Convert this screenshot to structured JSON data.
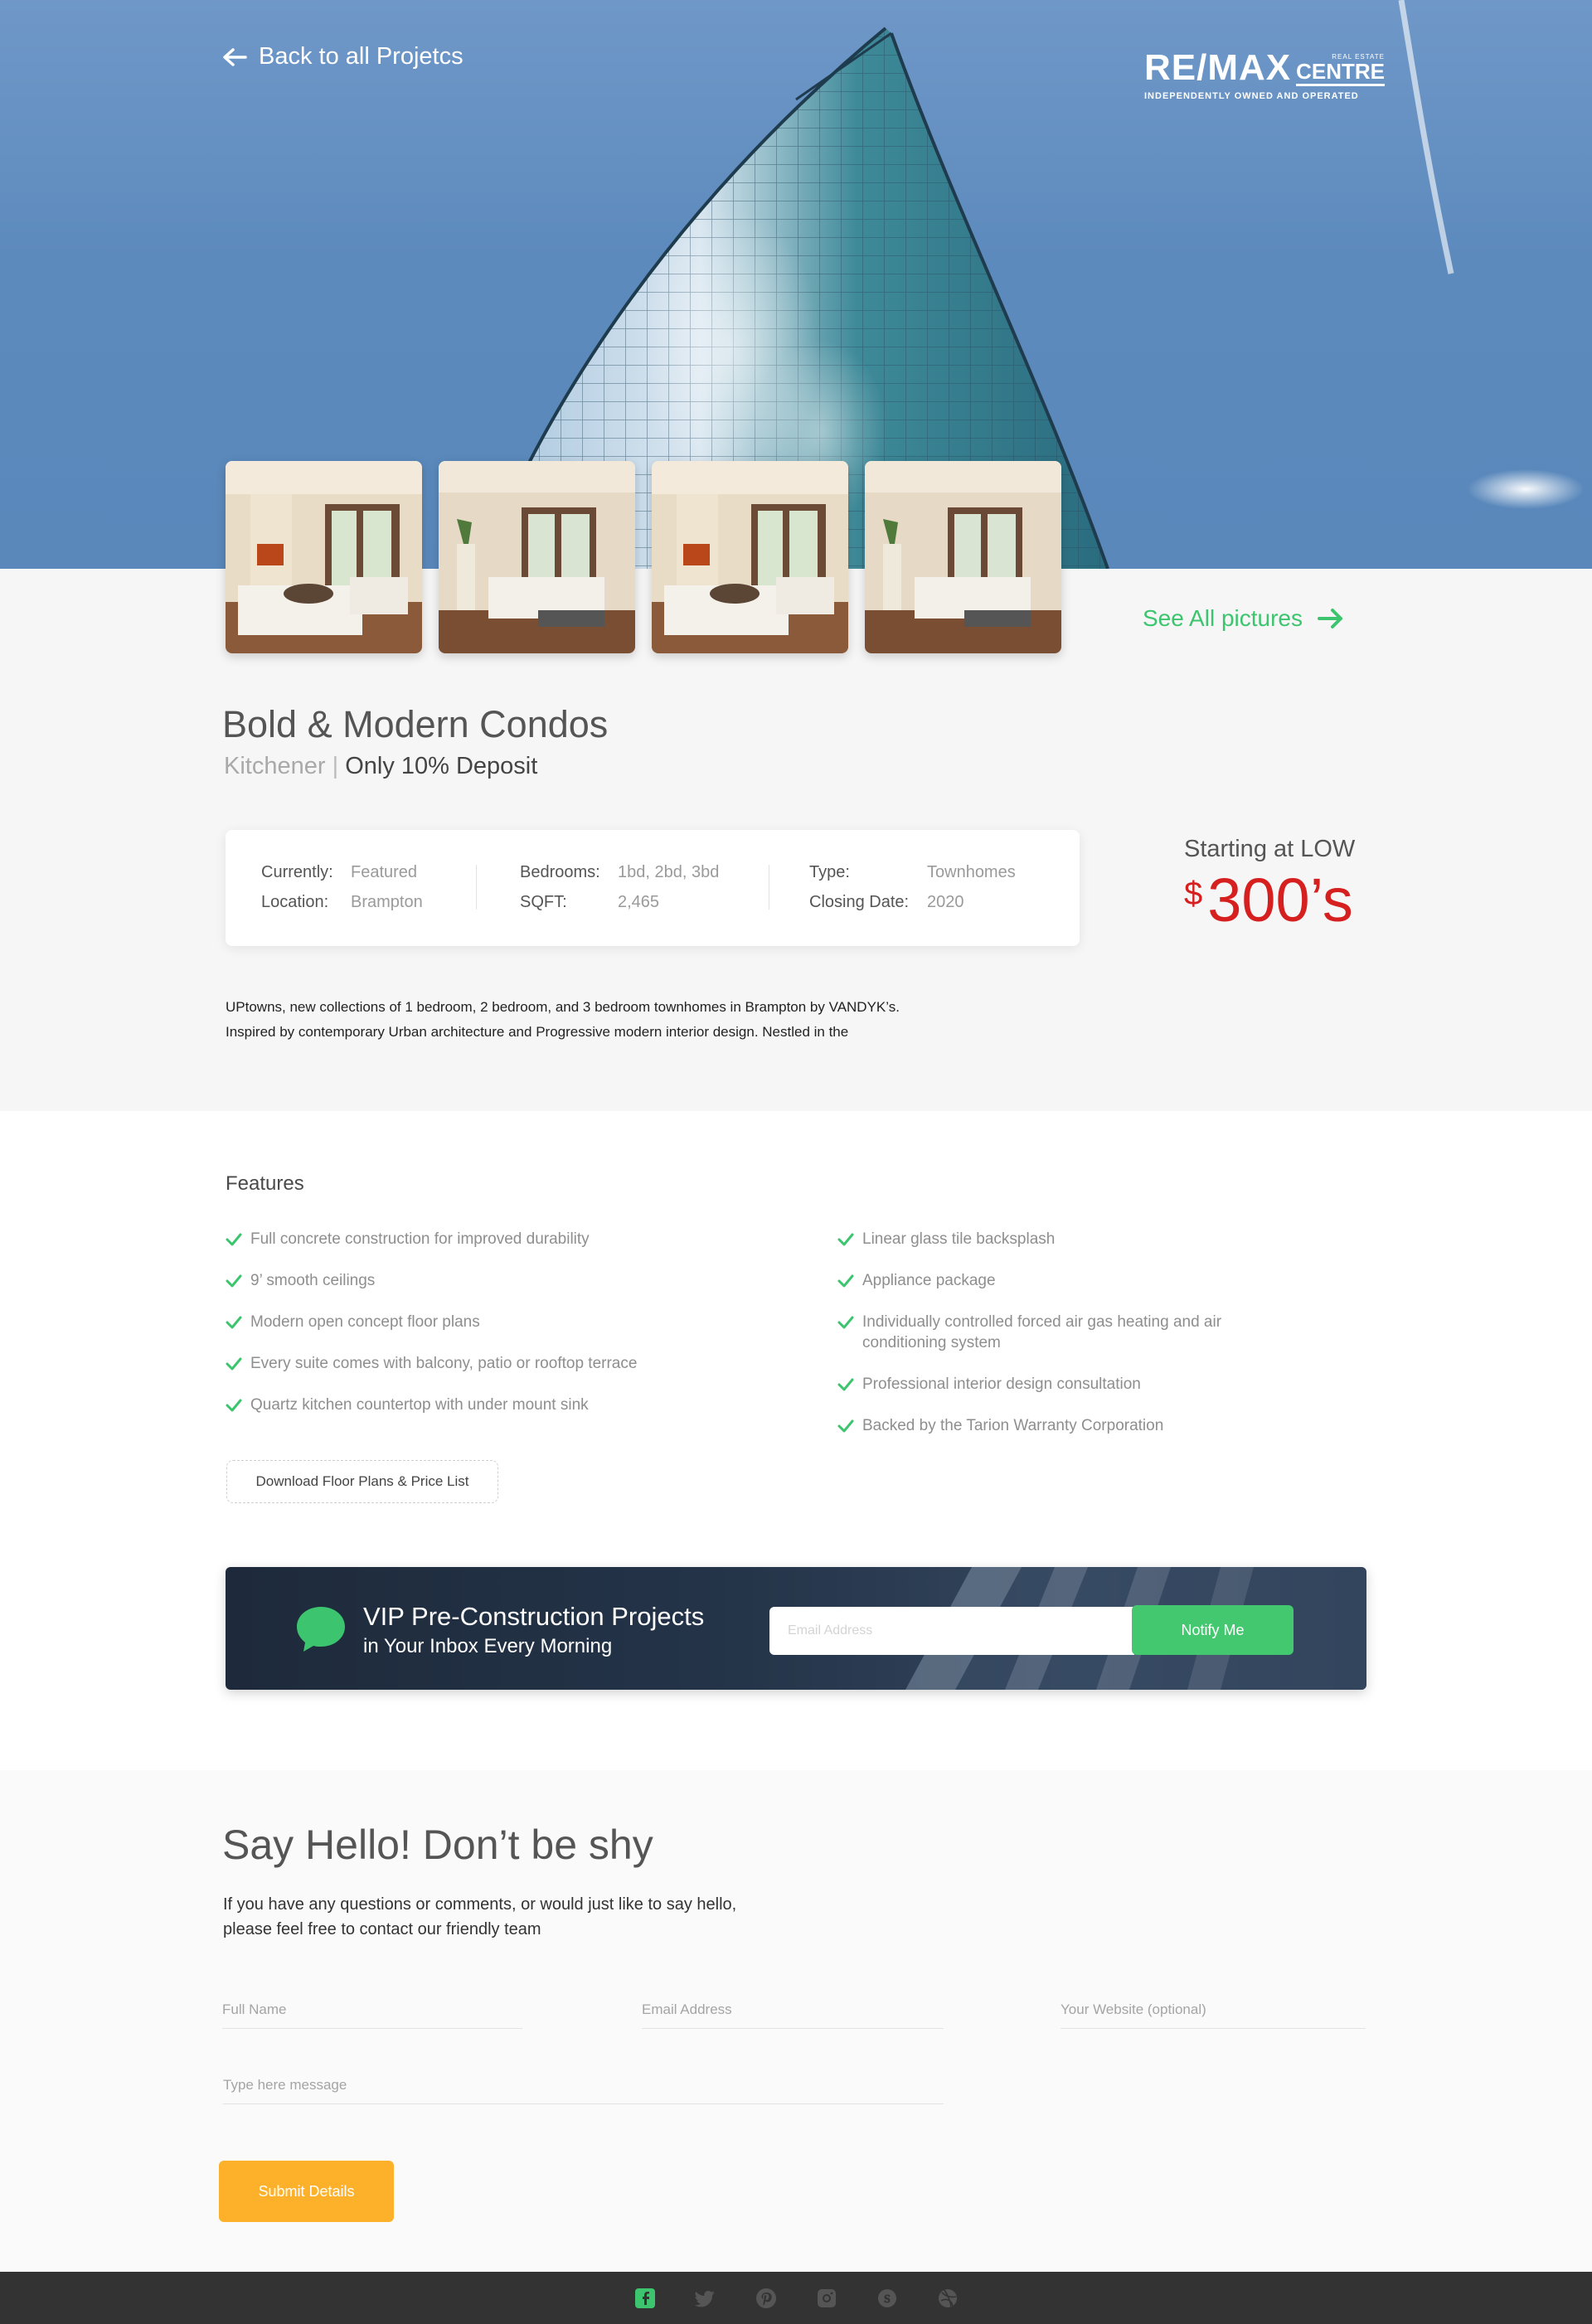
{
  "header": {
    "back_label": "Back to all Projetcs",
    "logo": {
      "brand": "RE/MAX",
      "small_top": "REAL ESTATE",
      "centre": "CENTRE",
      "tagline": "INDEPENDENTLY OWNED AND OPERATED"
    }
  },
  "gallery": {
    "see_all_label": "See All pictures",
    "thumbnail_count": 4
  },
  "project": {
    "title": "Bold & Modern Condos",
    "city": "Kitchener",
    "separator": "|",
    "deposit": "Only 10% Deposit",
    "details": {
      "currently_label": "Currently:",
      "currently_value": "Featured",
      "location_label": "Location:",
      "location_value": "Brampton",
      "bedrooms_label": "Bedrooms:",
      "bedrooms_value": "1bd, 2bd, 3bd",
      "sqft_label": "SQFT:",
      "sqft_value": "2,465",
      "type_label": "Type:",
      "type_value": "Townhomes",
      "closing_label": "Closing Date:",
      "closing_value": "2020"
    },
    "price_label": "Starting at LOW",
    "price_currency": "$",
    "price_value": "300’s",
    "description_line1": "UPtowns, new collections of 1 bedroom, 2 bedroom, and 3 bedroom townhomes in Brampton by VANDYK’s.",
    "description_line2": "Inspired by contemporary Urban architecture and Progressive modern interior design. Nestled in the"
  },
  "features": {
    "title": "Features",
    "left": [
      "Full concrete construction for improved durability",
      "9’ smooth ceilings",
      "Modern open concept floor plans",
      "Every suite comes with balcony, patio or rooftop terrace",
      "Quartz kitchen countertop with under mount sink"
    ],
    "right": [
      "Linear glass tile backsplash",
      "Appliance package",
      "Individually controlled forced air gas heating and air conditioning system",
      "Professional interior design consultation",
      "Backed by the Tarion Warranty Corporation"
    ],
    "download_label": "Download Floor Plans & Price List"
  },
  "newsletter": {
    "title": "VIP Pre-Construction Projects",
    "subtitle": "in Your Inbox Every Morning",
    "email_placeholder": "Email Address",
    "button_label": "Notify Me"
  },
  "contact": {
    "title": "Say Hello! Don’t be shy",
    "text_line1": "If you have any questions or comments, or would just like to say hello,",
    "text_line2": "please feel free to contact our friendly team",
    "fullname_placeholder": "Full Name",
    "email_placeholder": "Email Address",
    "website_placeholder": "Your Website (optional)",
    "message_placeholder": "Type here message",
    "submit_label": "Submit Details"
  },
  "footer": {
    "icons": [
      "facebook-icon",
      "twitter-icon",
      "pinterest-icon",
      "instagram-icon",
      "skype-icon",
      "dribbble-icon"
    ]
  },
  "colors": {
    "accent_green": "#3dc46e",
    "price_red": "#d61f1f",
    "submit_orange": "#fdb12a",
    "footer_dark": "#333333",
    "sky_blue": "#5d8abd"
  }
}
